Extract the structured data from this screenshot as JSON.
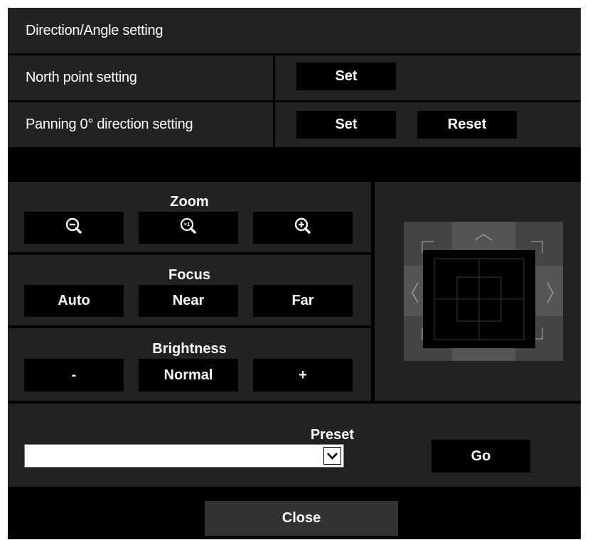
{
  "title": "Direction/Angle setting",
  "north_point": {
    "label": "North point setting",
    "set_label": "Set"
  },
  "panning": {
    "label": "Panning 0° direction setting",
    "set_label": "Set",
    "reset_label": "Reset"
  },
  "zoom": {
    "title": "Zoom",
    "buttons": [
      "zoom-out-icon",
      "zoom-x1-icon",
      "zoom-in-icon"
    ],
    "x1_text": "×1"
  },
  "focus": {
    "title": "Focus",
    "auto_label": "Auto",
    "near_label": "Near",
    "far_label": "Far"
  },
  "brightness": {
    "title": "Brightness",
    "minus_label": "-",
    "normal_label": "Normal",
    "plus_label": "+"
  },
  "preset": {
    "title": "Preset",
    "selected_value": "",
    "go_label": "Go"
  },
  "close_label": "Close",
  "colors": {
    "panel_bg": "#222222",
    "button_bg": "#000000",
    "pad_outer": "#444444",
    "pad_mid": "#555555",
    "text": "#ffffff"
  }
}
